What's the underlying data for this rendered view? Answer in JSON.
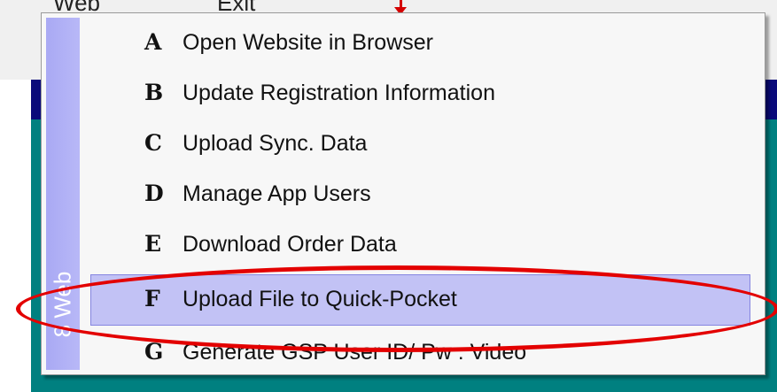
{
  "menubar": {
    "web_label": "Web",
    "web_mnemonic": "W",
    "exit_label": "Exit"
  },
  "popup": {
    "sidebar_label": "8 Web",
    "items": [
      {
        "key": "A",
        "label": "Open Website in Browser",
        "highlighted": false
      },
      {
        "key": "B",
        "label": "Update Registration Information",
        "highlighted": false
      },
      {
        "key": "C",
        "label": "Upload Sync. Data",
        "highlighted": false
      },
      {
        "key": "D",
        "label": "Manage App Users",
        "highlighted": false
      },
      {
        "key": "E",
        "label": "Download Order Data",
        "highlighted": false
      },
      {
        "key": "F",
        "label": "Upload File to Quick-Pocket",
        "highlighted": true
      },
      {
        "key": "G",
        "label": "Generate GSP User ID/ Pw : Video",
        "highlighted": false
      }
    ]
  },
  "colors": {
    "sidebar": "#a9a9f4",
    "highlight_fill": "#c2c2f5",
    "highlight_border": "#8585e0",
    "annotation": "#e30000",
    "title_strip": "#0a0a7a",
    "background_panel": "#008080"
  }
}
